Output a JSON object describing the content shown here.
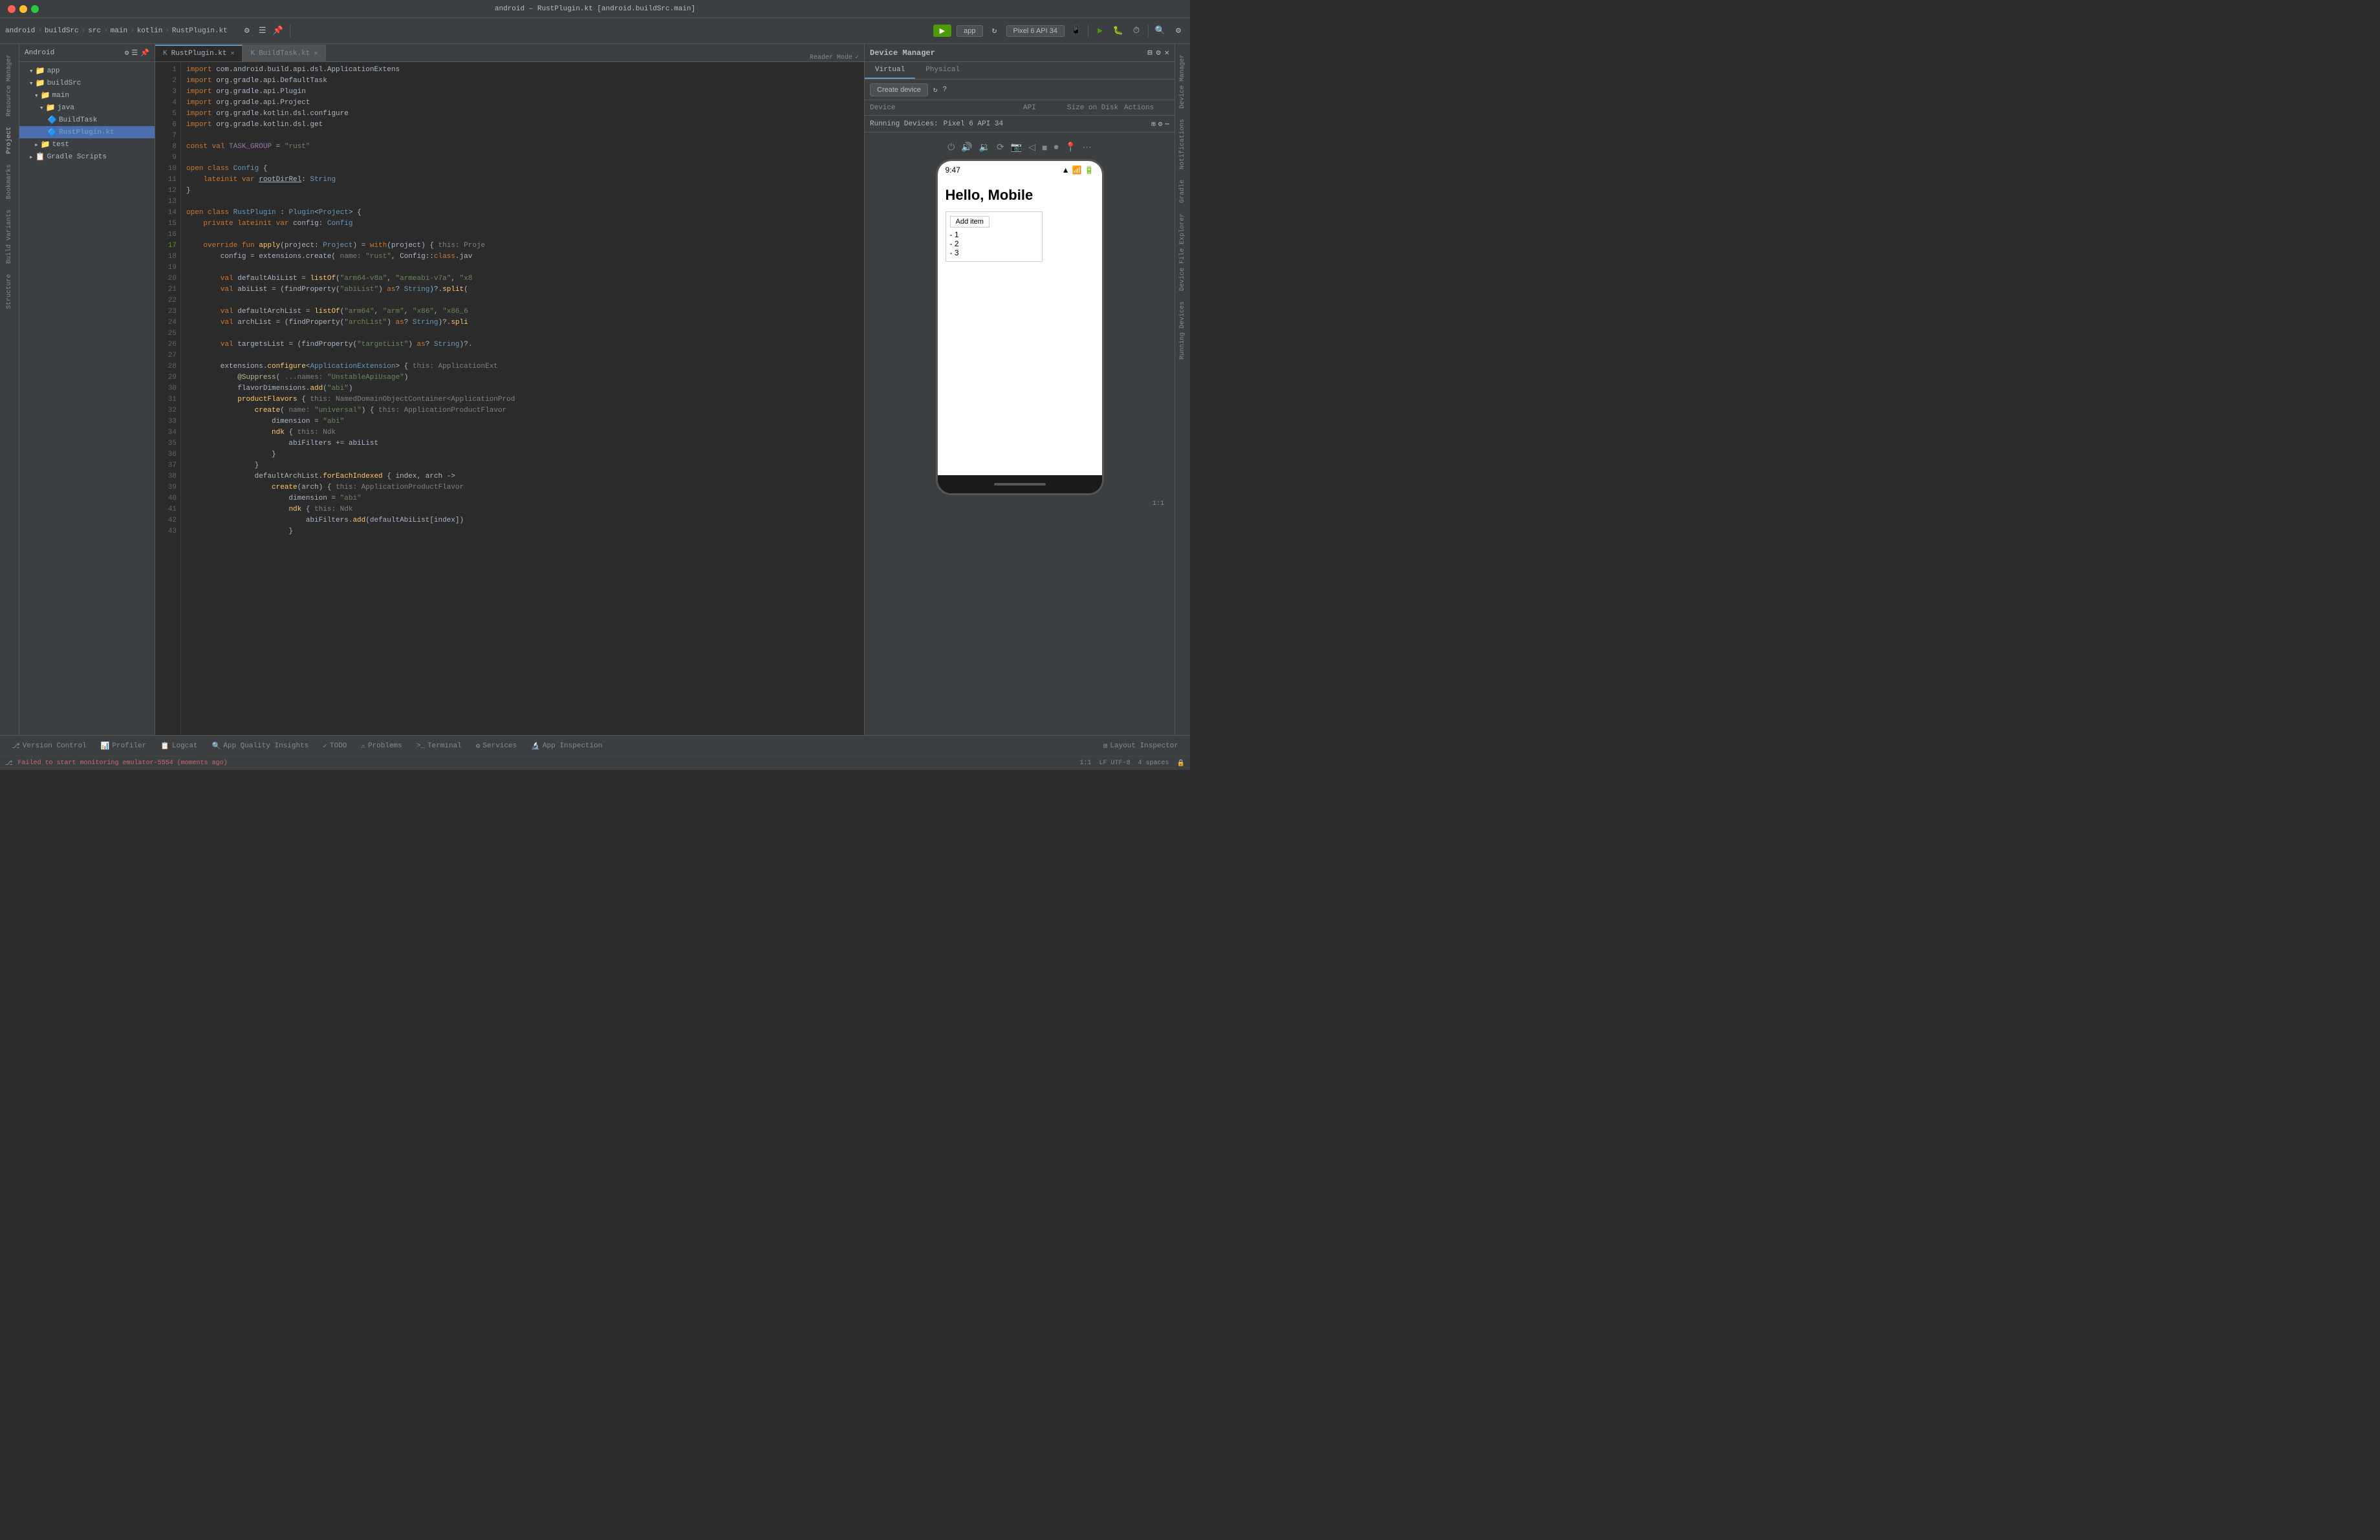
{
  "window": {
    "title": "android – RustPlugin.kt [android.buildSrc.main]",
    "traffic_lights": [
      "close",
      "minimize",
      "maximize"
    ]
  },
  "toolbar": {
    "breadcrumb": [
      "android",
      "buildSrc",
      "src",
      "main",
      "kotlin",
      "RustPlugin.kt"
    ],
    "run_config": "app",
    "device": "Pixel 6 API 34",
    "actions_label": "Actions"
  },
  "project_panel": {
    "title": "Android",
    "header_dropdown": "Android",
    "tree": [
      {
        "id": "app",
        "label": "app",
        "indent": 1,
        "type": "folder",
        "expanded": true
      },
      {
        "id": "buildSrc",
        "label": "buildSrc",
        "indent": 1,
        "type": "folder",
        "expanded": true
      },
      {
        "id": "main",
        "label": "main",
        "indent": 2,
        "type": "folder",
        "expanded": true
      },
      {
        "id": "java",
        "label": "java",
        "indent": 3,
        "type": "folder",
        "expanded": true
      },
      {
        "id": "BuildTask",
        "label": "BuildTask",
        "indent": 4,
        "type": "file-kt"
      },
      {
        "id": "RustPlugin",
        "label": "RustPlugin.kt",
        "indent": 4,
        "type": "file-kt",
        "selected": true
      },
      {
        "id": "test",
        "label": "test",
        "indent": 2,
        "type": "folder"
      },
      {
        "id": "GradleScripts",
        "label": "Gradle Scripts",
        "indent": 1,
        "type": "folder"
      }
    ]
  },
  "editor": {
    "tabs": [
      {
        "label": "RustPlugin.kt",
        "active": true,
        "icon": "kt"
      },
      {
        "label": "BuildTask.kt",
        "active": false,
        "icon": "kt"
      }
    ],
    "lines": [
      {
        "num": 1,
        "content": "import com.android.build.api.dsl.ApplicationExtens",
        "tokens": [
          {
            "t": "kw",
            "v": "import"
          },
          {
            "t": "normal",
            "v": " com.android.build.api.dsl.ApplicationExtens"
          }
        ]
      },
      {
        "num": 2,
        "content": "import org.gradle.api.DefaultTask"
      },
      {
        "num": 3,
        "content": "import org.gradle.api.Plugin"
      },
      {
        "num": 4,
        "content": "import org.gradle.api.Project"
      },
      {
        "num": 5,
        "content": "import org.gradle.kotlin.dsl.configure"
      },
      {
        "num": 6,
        "content": "import org.gradle.kotlin.dsl.get"
      },
      {
        "num": 7,
        "content": ""
      },
      {
        "num": 8,
        "content": "const val TASK_GROUP = \"rust\""
      },
      {
        "num": 9,
        "content": ""
      },
      {
        "num": 10,
        "content": "open class Config {"
      },
      {
        "num": 11,
        "content": "    lateinit var rootDirRel: String"
      },
      {
        "num": 12,
        "content": "}"
      },
      {
        "num": 13,
        "content": ""
      },
      {
        "num": 14,
        "content": "open class RustPlugin : Plugin<Project> {"
      },
      {
        "num": 15,
        "content": "    private lateinit var config: Config"
      },
      {
        "num": 16,
        "content": ""
      },
      {
        "num": 17,
        "content": "    override fun apply(project: Project) = with(project) { this: Proje"
      },
      {
        "num": 18,
        "content": "        config = extensions.create( name: \"rust\", Config::class.jav"
      },
      {
        "num": 19,
        "content": ""
      },
      {
        "num": 20,
        "content": "        val defaultAbiList = listOf(\"arm64-v8a\", \"armeabi-v7a\", \"x8"
      },
      {
        "num": 21,
        "content": "        val abiList = (findProperty(\"abiList\") as? String)?.split("
      },
      {
        "num": 22,
        "content": ""
      },
      {
        "num": 23,
        "content": "        val defaultArchList = listOf(\"arm64\", \"arm\", \"x86\", \"x86_6"
      },
      {
        "num": 24,
        "content": "        val archList = (findProperty(\"archList\") as? String)?.spli"
      },
      {
        "num": 25,
        "content": ""
      },
      {
        "num": 26,
        "content": "        val targetsList = (findProperty(\"targetList\") as? String)?."
      },
      {
        "num": 27,
        "content": ""
      },
      {
        "num": 28,
        "content": "        extensions.configure<ApplicationExtension> { this: ApplicationExt"
      },
      {
        "num": 29,
        "content": "            @Suppress( ...names: \"UnstableApiUsage\")"
      },
      {
        "num": 30,
        "content": "            flavorDimensions.add(\"abi\")"
      },
      {
        "num": 31,
        "content": "            productFlavors { this: NamedDomainObjectContainer<ApplicationProd"
      },
      {
        "num": 32,
        "content": "                create( name: \"universal\") { this: ApplicationProductFlavor"
      },
      {
        "num": 33,
        "content": "                    dimension = \"abi\""
      },
      {
        "num": 34,
        "content": "                    ndk { this: Ndk"
      },
      {
        "num": 35,
        "content": "                        abiFilters += abiList"
      },
      {
        "num": 36,
        "content": "                    }"
      },
      {
        "num": 37,
        "content": "                }"
      },
      {
        "num": 38,
        "content": "                defaultArchList.forEachIndexed { index, arch ->"
      },
      {
        "num": 39,
        "content": "                    create(arch) { this: ApplicationProductFlavor"
      },
      {
        "num": 40,
        "content": "                        dimension = \"abi\""
      },
      {
        "num": 41,
        "content": "                        ndk { this: Ndk"
      },
      {
        "num": 42,
        "content": "                            abiFilters.add(defaultAbiList[index])"
      },
      {
        "num": 43,
        "content": "                        }"
      }
    ]
  },
  "device_manager": {
    "title": "Device Manager",
    "tabs": [
      "Virtual",
      "Physical"
    ],
    "active_tab": "Virtual",
    "create_device_label": "Create device",
    "refresh_icon": "↻",
    "help_icon": "?",
    "device_dropdown": "Device",
    "api_label": "API",
    "size_on_disk_label": "Size on Disk",
    "actions_label": "Actions",
    "running_devices_label": "Running Devices:",
    "running_device": "Pixel 6 API 34",
    "columns": [
      "Device",
      "API",
      "Size on Disk",
      "Actions"
    ],
    "devices": [],
    "screen": {
      "time": "9:47",
      "title": "Hello, Mobile",
      "add_item_label": "Add item",
      "list_items": [
        "- 1",
        "- 2",
        "- 3"
      ]
    }
  },
  "bottom_tabs": [
    {
      "label": "Version Control",
      "icon": "⎇",
      "active": false
    },
    {
      "label": "Profiler",
      "icon": "📊",
      "active": false
    },
    {
      "label": "Logcat",
      "icon": "📋",
      "active": false
    },
    {
      "label": "App Quality Insights",
      "icon": "🔍",
      "active": false
    },
    {
      "label": "TODO",
      "icon": "✓",
      "active": false
    },
    {
      "label": "Problems",
      "icon": "⚠",
      "active": false
    },
    {
      "label": "Terminal",
      "icon": ">_",
      "active": false
    },
    {
      "label": "Services",
      "icon": "⚙",
      "active": false
    },
    {
      "label": "App Inspection",
      "icon": "🔬",
      "active": false
    },
    {
      "label": "Layout Inspector",
      "icon": "⊞",
      "active": false
    }
  ],
  "status_bar": {
    "error_message": "Failed to start monitoring emulator-5554 (moments ago)",
    "line_col": "1:1",
    "encoding": "LF  UTF-8",
    "indent": "4 spaces"
  },
  "right_sidebar_tabs": [
    "Device Manager",
    "Notifications",
    "Gradle",
    "Device File Explorer",
    "Running Devices"
  ],
  "left_sidebar_tabs": [
    "Resource Manager",
    "Project",
    "Bookmarks",
    "Build Variants",
    "Structure"
  ]
}
